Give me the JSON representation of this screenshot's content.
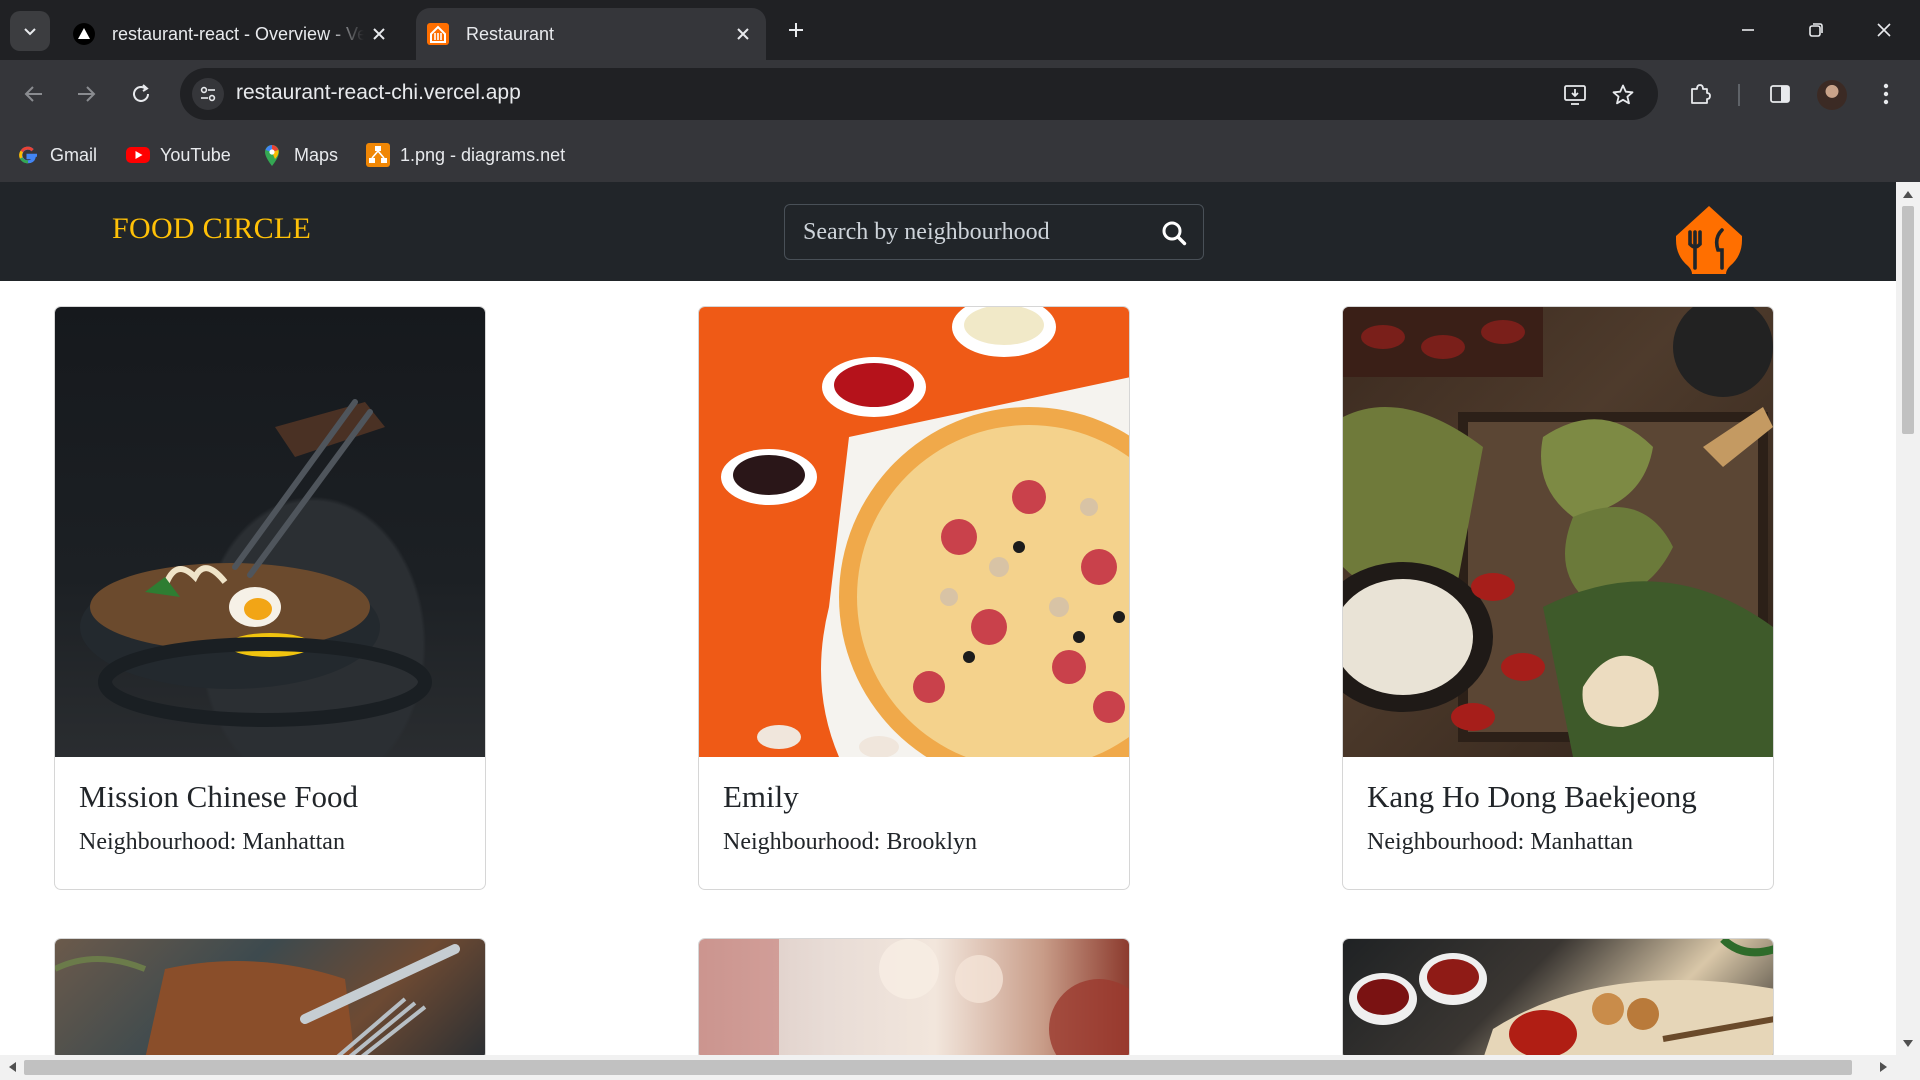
{
  "browser": {
    "tabs": [
      {
        "title": "restaurant-react - Overview - Vercel",
        "active": false
      },
      {
        "title": "Restaurant",
        "active": true
      }
    ],
    "url": "restaurant-react-chi.vercel.app",
    "bookmarks": [
      {
        "label": "Gmail",
        "icon": "gmail-icon"
      },
      {
        "label": "YouTube",
        "icon": "youtube-icon"
      },
      {
        "label": "Maps",
        "icon": "maps-icon"
      },
      {
        "label": "1.png - diagrams.net",
        "icon": "diagrams-icon"
      }
    ]
  },
  "site": {
    "brand": "FOOD CIRCLE",
    "search_placeholder": "Search by neighbourhood",
    "accent_color": "#ffc107",
    "logo_color": "#ff6f00",
    "navbar_color": "#212529"
  },
  "restaurants": [
    {
      "name": "Mission Chinese Food",
      "neighbourhood": "Neighbourhood: Manhattan",
      "photo": "ramen-bowl-with-chopsticks"
    },
    {
      "name": "Emily",
      "neighbourhood": "Neighbourhood: Brooklyn",
      "photo": "pizza-on-orange-background"
    },
    {
      "name": "Kang Ho Dong Baekjeong",
      "neighbourhood": "Neighbourhood: Manhattan",
      "photo": "rice-dumplings-and-dates"
    },
    {
      "name": "",
      "neighbourhood": "",
      "photo": "steak-board-with-knife-and-fork"
    },
    {
      "name": "",
      "neighbourhood": "",
      "photo": "blurred-restaurant-interior"
    },
    {
      "name": "",
      "neighbourhood": "",
      "photo": "grilled-skewers-and-sauces"
    }
  ]
}
